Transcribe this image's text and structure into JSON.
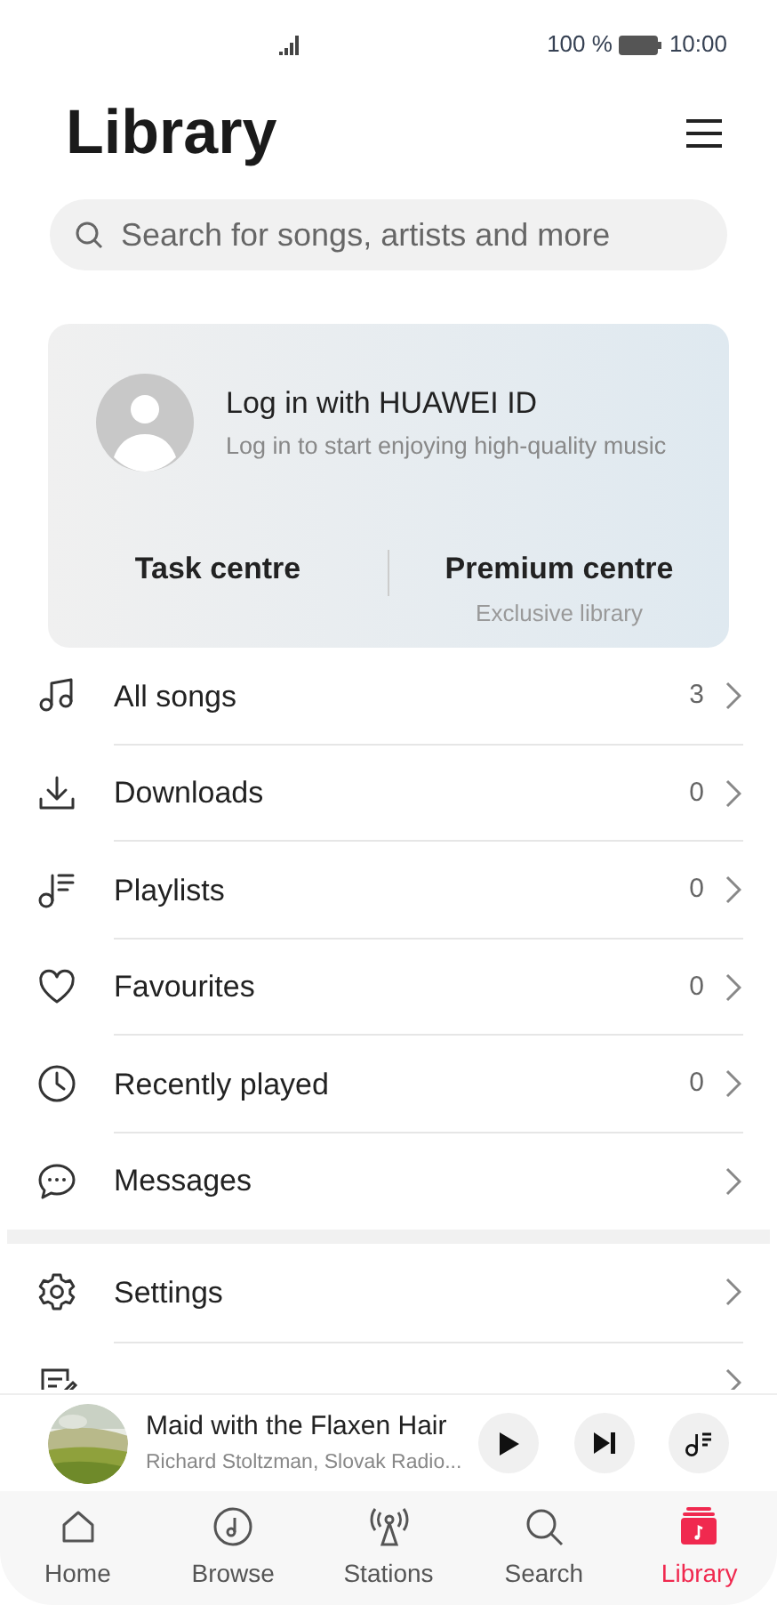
{
  "status_bar": {
    "battery": "100 %",
    "time": "10:00"
  },
  "title": "Library",
  "search": {
    "placeholder": "Search for songs, artists and more"
  },
  "account": {
    "title": "Log in with HUAWEI ID",
    "subtitle": "Log in to start enjoying high-quality music"
  },
  "shortcuts": [
    {
      "label": "Task centre"
    },
    {
      "label": "Premium centre",
      "subtitle": "Exclusive library"
    }
  ],
  "menu": [
    {
      "label": "All songs",
      "count": "3"
    },
    {
      "label": "Downloads",
      "count": "0"
    },
    {
      "label": "Playlists",
      "count": "0"
    },
    {
      "label": "Favourites",
      "count": "0"
    },
    {
      "label": "Recently played",
      "count": "0"
    },
    {
      "label": "Messages"
    }
  ],
  "menu_2": [
    {
      "label": "Settings"
    }
  ],
  "now_playing": {
    "title": "Maid with the Flaxen Hair",
    "artist": "Richard Stoltzman, Slovak Radio..."
  },
  "nav": [
    {
      "label": "Home",
      "selected": false
    },
    {
      "label": "Browse",
      "selected": false
    },
    {
      "label": "Stations",
      "selected": false
    },
    {
      "label": "Search",
      "selected": false
    },
    {
      "label": "Library",
      "selected": true
    }
  ]
}
